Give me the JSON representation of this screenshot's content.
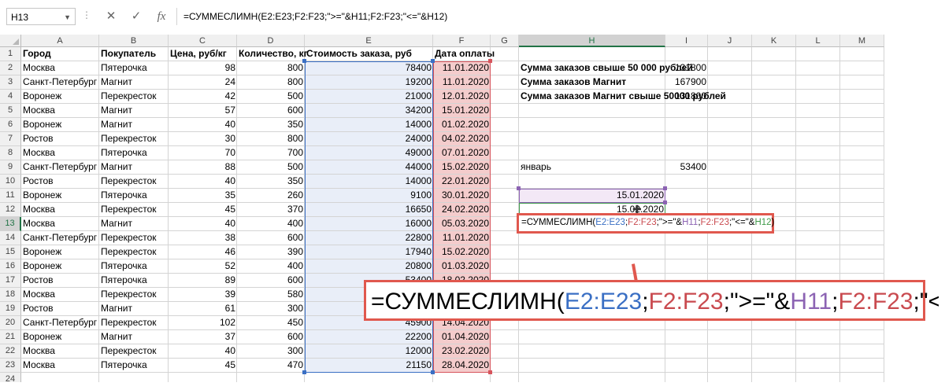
{
  "formula_bar": {
    "name_box": "H13",
    "dots": "⋮",
    "cancel_icon": "✕",
    "enter_icon": "✓",
    "fx_label": "fx",
    "formula": "=СУММЕСЛИМН(E2:E23;F2:F23;\">=\"&H11;F2:F23;\"<=\"&H12)"
  },
  "columns": [
    "A",
    "B",
    "C",
    "D",
    "E",
    "F",
    "G",
    "H",
    "I",
    "J",
    "K",
    "L",
    "M"
  ],
  "rows": [
    "1",
    "2",
    "3",
    "4",
    "5",
    "6",
    "7",
    "8",
    "9",
    "10",
    "11",
    "12",
    "13",
    "14",
    "15",
    "16",
    "17",
    "18",
    "19",
    "20",
    "21",
    "22",
    "23",
    "24"
  ],
  "header": {
    "a": "Город",
    "b": "Покупатель",
    "c": "Цена, руб/кг",
    "d": "Количество, кг",
    "e": "Стоимость заказа, руб",
    "f": "Дата оплаты"
  },
  "table": [
    [
      "Москва",
      "Пятерочка",
      "98",
      "800",
      "78400",
      "11.01.2020"
    ],
    [
      "Санкт-Петербург",
      "Магнит",
      "24",
      "800",
      "19200",
      "11.01.2020"
    ],
    [
      "Воронеж",
      "Перекресток",
      "42",
      "500",
      "21000",
      "12.01.2020"
    ],
    [
      "Москва",
      "Магнит",
      "57",
      "600",
      "34200",
      "15.01.2020"
    ],
    [
      "Воронеж",
      "Магнит",
      "40",
      "350",
      "14000",
      "01.02.2020"
    ],
    [
      "Ростов",
      "Перекресток",
      "30",
      "800",
      "24000",
      "04.02.2020"
    ],
    [
      "Москва",
      "Пятерочка",
      "70",
      "700",
      "49000",
      "07.01.2020"
    ],
    [
      "Санкт-Петербург",
      "Магнит",
      "88",
      "500",
      "44000",
      "15.02.2020"
    ],
    [
      "Ростов",
      "Перекресток",
      "40",
      "350",
      "14000",
      "22.01.2020"
    ],
    [
      "Воронеж",
      "Пятерочка",
      "35",
      "260",
      "9100",
      "30.01.2020"
    ],
    [
      "Москва",
      "Перекресток",
      "45",
      "370",
      "16650",
      "24.02.2020"
    ],
    [
      "Москва",
      "Магнит",
      "40",
      "400",
      "16000",
      "05.03.2020"
    ],
    [
      "Санкт-Петербург",
      "Перекресток",
      "38",
      "600",
      "22800",
      "11.01.2020"
    ],
    [
      "Воронеж",
      "Перекресток",
      "46",
      "390",
      "17940",
      "15.02.2020"
    ],
    [
      "Воронеж",
      "Пятерочка",
      "52",
      "400",
      "20800",
      "01.03.2020"
    ],
    [
      "Ростов",
      "Пятерочка",
      "89",
      "600",
      "53400",
      "18.02.2020"
    ],
    [
      "Москва",
      "Перекресток",
      "39",
      "580",
      "",
      ""
    ],
    [
      "Ростов",
      "Магнит",
      "61",
      "300",
      "",
      ""
    ],
    [
      "Санкт-Петербург",
      "Перекресток",
      "102",
      "450",
      "45900",
      "14.04.2020"
    ],
    [
      "Воронеж",
      "Магнит",
      "37",
      "600",
      "22200",
      "01.04.2020"
    ],
    [
      "Москва",
      "Перекресток",
      "40",
      "300",
      "12000",
      "23.02.2020"
    ],
    [
      "Москва",
      "Пятерочка",
      "45",
      "470",
      "21150",
      "28.04.2020"
    ]
  ],
  "summary": {
    "h2": "Сумма заказов свыше 50 000 рублей",
    "i2": "131800",
    "h3": "Сумма заказов Магнит",
    "i3": "167900",
    "h4": "Сумма заказов Магнит свыше 50000 рублей",
    "i4": "131800",
    "h9": "январь",
    "i9": "53400",
    "h11": "15.01.2020",
    "h12": "15.02.2020"
  },
  "editing": {
    "p1": "=СУММЕСЛИМН(",
    "p2": "E2:E23",
    "p3": ";",
    "p4": "F2:F23",
    "p5": ";\">=\"&",
    "p6": "H11",
    "p7": ";",
    "p8": "F2:F23",
    "p9": ";\"<=\"&",
    "p10": "H12",
    "p11": ")"
  },
  "colors": {
    "accent_green": "#217346",
    "range_blue": "#3a6fc4",
    "range_red": "#d7545c",
    "range_purple": "#8c63b3",
    "range_green": "#3f9a4a",
    "annotation": "#e0584e"
  }
}
